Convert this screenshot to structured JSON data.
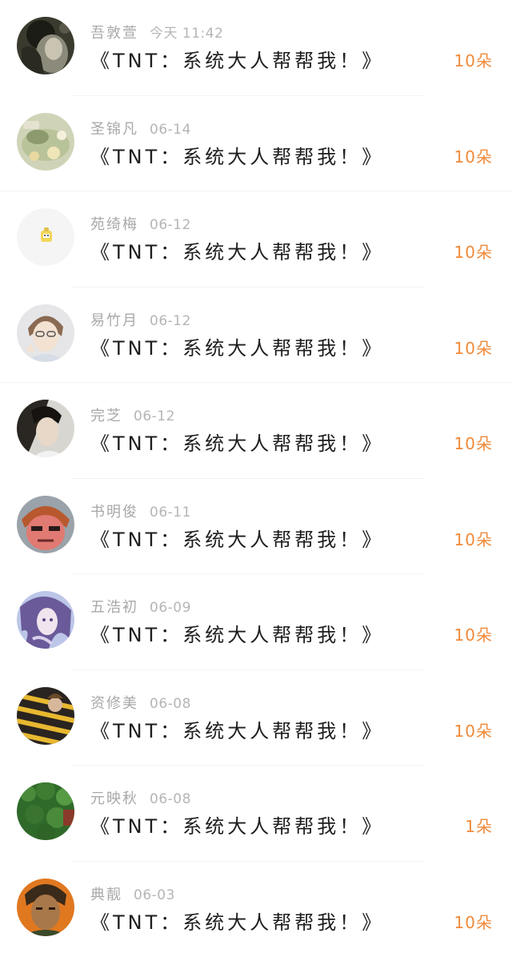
{
  "rows": [
    {
      "name": "吾敦萱",
      "time": "今天 11:42",
      "title": "《TNT：系统大人帮帮我！》",
      "gift": "10朵",
      "avatar": "avatar-1"
    },
    {
      "name": "圣锦凡",
      "time": "06-14",
      "title": "《TNT：系统大人帮帮我！》",
      "gift": "10朵",
      "avatar": "avatar-2"
    },
    {
      "name": "苑绮梅",
      "time": "06-12",
      "title": "《TNT：系统大人帮帮我！》",
      "gift": "10朵",
      "avatar": "avatar-3"
    },
    {
      "name": "易竹月",
      "time": "06-12",
      "title": "《TNT：系统大人帮帮我！》",
      "gift": "10朵",
      "avatar": "avatar-4"
    },
    {
      "name": "完芝",
      "time": "06-12",
      "title": "《TNT：系统大人帮帮我！》",
      "gift": "10朵",
      "avatar": "avatar-5"
    },
    {
      "name": "书明俊",
      "time": "06-11",
      "title": "《TNT：系统大人帮帮我！》",
      "gift": "10朵",
      "avatar": "avatar-6"
    },
    {
      "name": "五浩初",
      "time": "06-09",
      "title": "《TNT：系统大人帮帮我！》",
      "gift": "10朵",
      "avatar": "avatar-7"
    },
    {
      "name": "资修美",
      "time": "06-08",
      "title": "《TNT：系统大人帮帮我！》",
      "gift": "10朵",
      "avatar": "avatar-8"
    },
    {
      "name": "元映秋",
      "time": "06-08",
      "title": "《TNT：系统大人帮帮我！》",
      "gift": "1朵",
      "avatar": "avatar-9"
    },
    {
      "name": "典靓",
      "time": "06-03",
      "title": "《TNT：系统大人帮帮我！》",
      "gift": "10朵",
      "avatar": "avatar-10"
    }
  ],
  "colors": {
    "accent_gift": "#f08a3a",
    "meta_gray": "#a8a8a8",
    "title_text": "#1e1e1e",
    "divider": "#f3f3f3"
  }
}
